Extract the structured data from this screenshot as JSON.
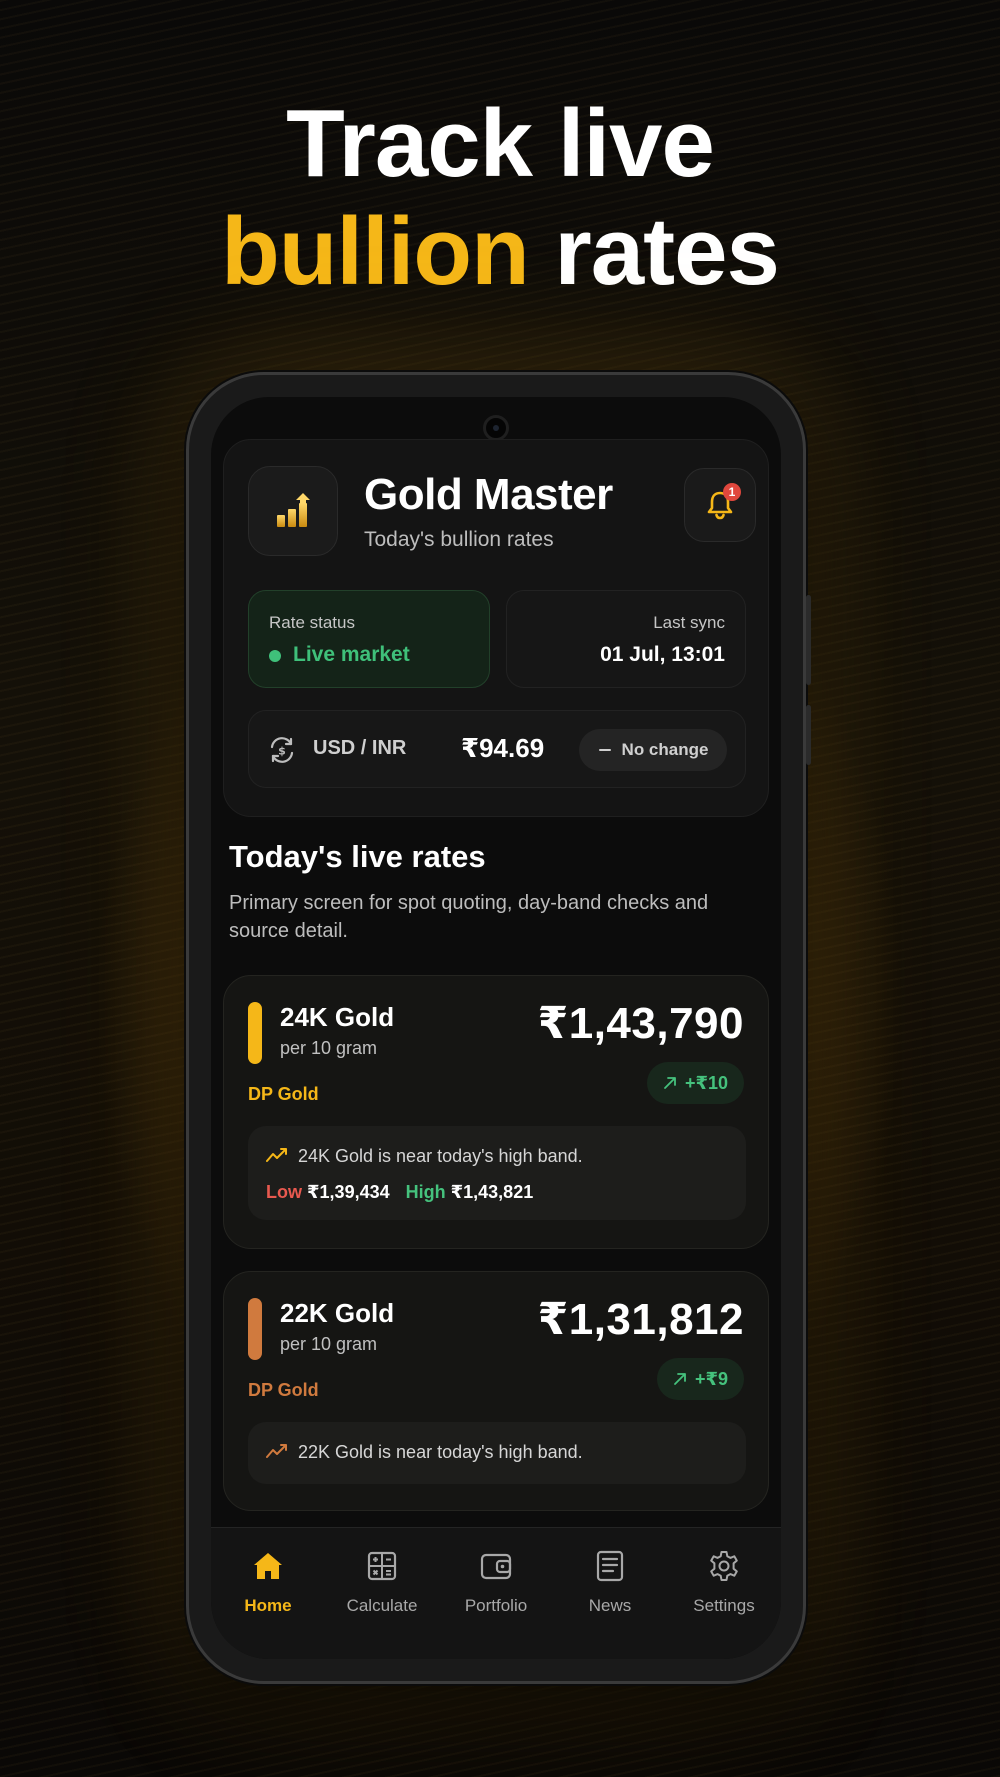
{
  "headline": {
    "line1": "Track live",
    "line2_highlight": "bullion",
    "line2_rest": "rates"
  },
  "colors": {
    "accent_gold": "#f5b718",
    "accent_copper": "#d07a3e",
    "positive": "#45c27d",
    "negative": "#e8594f",
    "background": "#0c0c0c"
  },
  "app": {
    "title": "Gold Master",
    "subtitle": "Today's bullion rates",
    "icon": "bar-chart-up-icon",
    "notifications": {
      "icon": "bell-icon",
      "badge_count": "1"
    }
  },
  "status": {
    "rate_label": "Rate status",
    "rate_value": "Live market",
    "sync_label": "Last sync",
    "sync_value": "01 Jul, 13:01"
  },
  "fx": {
    "icon": "currency-exchange-icon",
    "pair": "USD / INR",
    "value": "₹94.69",
    "change_icon": "minus-icon",
    "change": "No change"
  },
  "section": {
    "title": "Today's live rates",
    "description": "Primary screen for spot quoting, day-band checks and source detail."
  },
  "rates": [
    {
      "name": "24K Gold",
      "unit": "per 10 gram",
      "source": "DP Gold",
      "price": "₹1,43,790",
      "change": "+₹10",
      "change_icon": "arrow-up-right-icon",
      "accent": "#f5b718",
      "note": "24K Gold is near today's high band.",
      "low_label": "Low",
      "low_value": "₹1,39,434",
      "high_label": "High",
      "high_value": "₹1,43,821"
    },
    {
      "name": "22K Gold",
      "unit": "per 10 gram",
      "source": "DP Gold",
      "price": "₹1,31,812",
      "change": "+₹9",
      "change_icon": "arrow-up-right-icon",
      "accent": "#d07a3e",
      "note": "22K Gold is near today's high band."
    }
  ],
  "tabs": [
    {
      "label": "Home",
      "icon": "home-icon",
      "active": true
    },
    {
      "label": "Calculate",
      "icon": "calculator-icon",
      "active": false
    },
    {
      "label": "Portfolio",
      "icon": "wallet-icon",
      "active": false
    },
    {
      "label": "News",
      "icon": "news-icon",
      "active": false
    },
    {
      "label": "Settings",
      "icon": "gear-icon",
      "active": false
    }
  ]
}
